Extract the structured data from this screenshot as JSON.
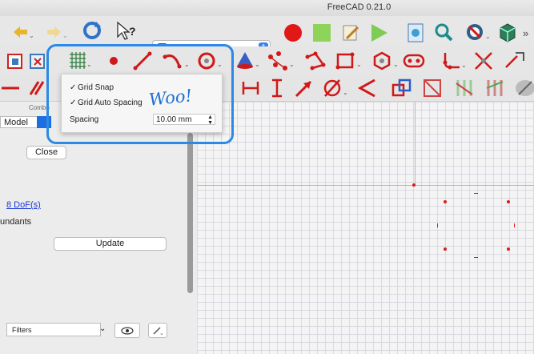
{
  "app": {
    "title": "FreeCAD 0.21.0"
  },
  "workbench": {
    "selected": "Sketcher"
  },
  "panel": {
    "combo_label": "Combo",
    "model_tab": "Model",
    "close_label": "Close",
    "dof_link": "8 DoF(s)",
    "redundants_text": "undants",
    "update_label": "Update",
    "filters_label": "Filters"
  },
  "grid_popup": {
    "grid_snap": "Grid Snap",
    "grid_auto_spacing": "Grid Auto Spacing",
    "spacing_label": "Spacing",
    "spacing_value": "10.00 mm",
    "grid_snap_checked": true,
    "grid_auto_spacing_checked": true
  },
  "annotation": {
    "text": "Woo!"
  },
  "colors": {
    "highlight": "#2a8ae6",
    "record": "#e01818",
    "accent": "#1d6fe0"
  },
  "icons": [
    "back-icon",
    "forward-icon",
    "refresh-icon",
    "whats-this-icon",
    "record-macro-icon",
    "stop-macro-icon",
    "edit-macro-icon",
    "play-macro-icon",
    "view-fit-icon",
    "zoom-icon",
    "draw-style-icon",
    "std-view-icon",
    "grid-icon",
    "point-icon",
    "line-icon",
    "arc-icon",
    "circle-icon",
    "conic-icon",
    "bspline-icon",
    "polyline-icon",
    "rectangle-icon",
    "polygon-icon",
    "slot-icon",
    "fillet-icon",
    "trim-icon",
    "extend-icon"
  ]
}
